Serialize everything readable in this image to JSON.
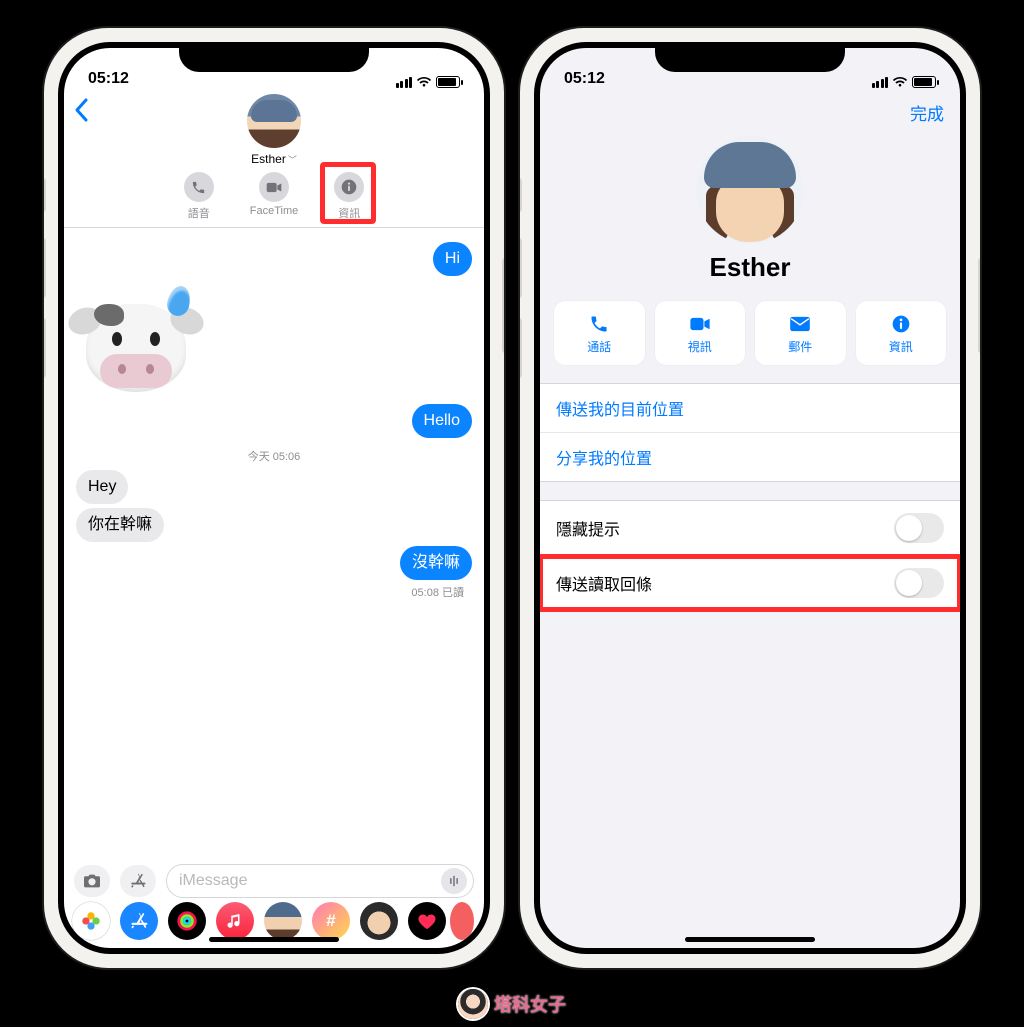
{
  "status": {
    "time": "05:12"
  },
  "left": {
    "contact_name": "Esther",
    "actions": {
      "audio_label": "語音",
      "facetime_label": "FaceTime",
      "info_label": "資訊"
    },
    "messages": {
      "m1": "Hi",
      "m2": "Hello",
      "divider": "今天 05:06",
      "m3": "Hey",
      "m4": "你在幹嘛",
      "m5": "沒幹嘛",
      "receipt": "05:08 已讀"
    },
    "input_placeholder": "iMessage"
  },
  "right": {
    "done_label": "完成",
    "contact_name": "Esther",
    "tiles": {
      "call": "通話",
      "video": "視訊",
      "mail": "郵件",
      "info": "資訊"
    },
    "location_group": {
      "send_current": "傳送我的目前位置",
      "share": "分享我的位置"
    },
    "settings_group": {
      "hide_alerts": "隱藏提示",
      "read_receipts": "傳送讀取回條"
    }
  },
  "watermark": "塔科女子"
}
